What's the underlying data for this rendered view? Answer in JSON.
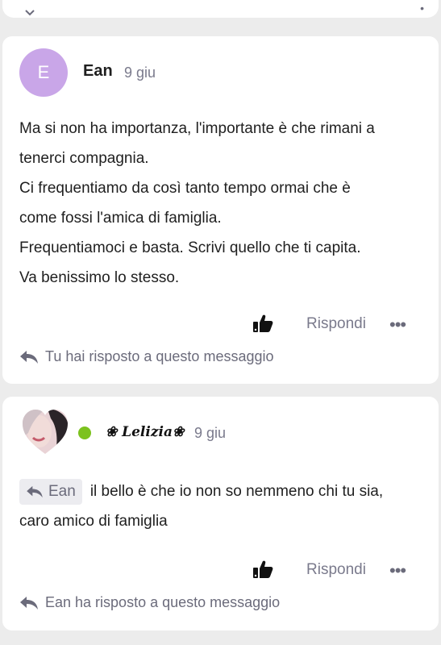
{
  "comments": [
    {
      "avatar_letter": "E",
      "author": "Ean",
      "date": "9 giu",
      "lines": [
        "Ma si non ha importanza, l'importante è che rimani a",
        "tenerci compagnia.",
        "Ci frequentiamo da così tanto tempo ormai che è",
        "come fossi l'amica di famiglia.",
        "Frequentiamoci e basta. Scrivi quello che ti capita.",
        "Va benissimo lo stesso."
      ],
      "reply_label": "Rispondi",
      "replied_text": "Tu hai risposto a questo messaggio"
    },
    {
      "author": "❀ Lelizia❀",
      "date": "9 giu",
      "mention": "Ean",
      "line1": "il bello è che io non so nemmeno chi tu sia,",
      "line2": "caro amico di famiglia",
      "reply_label": "Rispondi",
      "replied_text": "Ean ha risposto a questo messaggio"
    }
  ],
  "icons": {
    "like": "thumbs-up-icon",
    "more": "more-horizontal-icon",
    "reply_arrow": "reply-arrow-icon"
  },
  "colors": {
    "avatar_bg": "#c9a6e8",
    "online": "#7cc21e",
    "muted": "#7a7a8c"
  }
}
